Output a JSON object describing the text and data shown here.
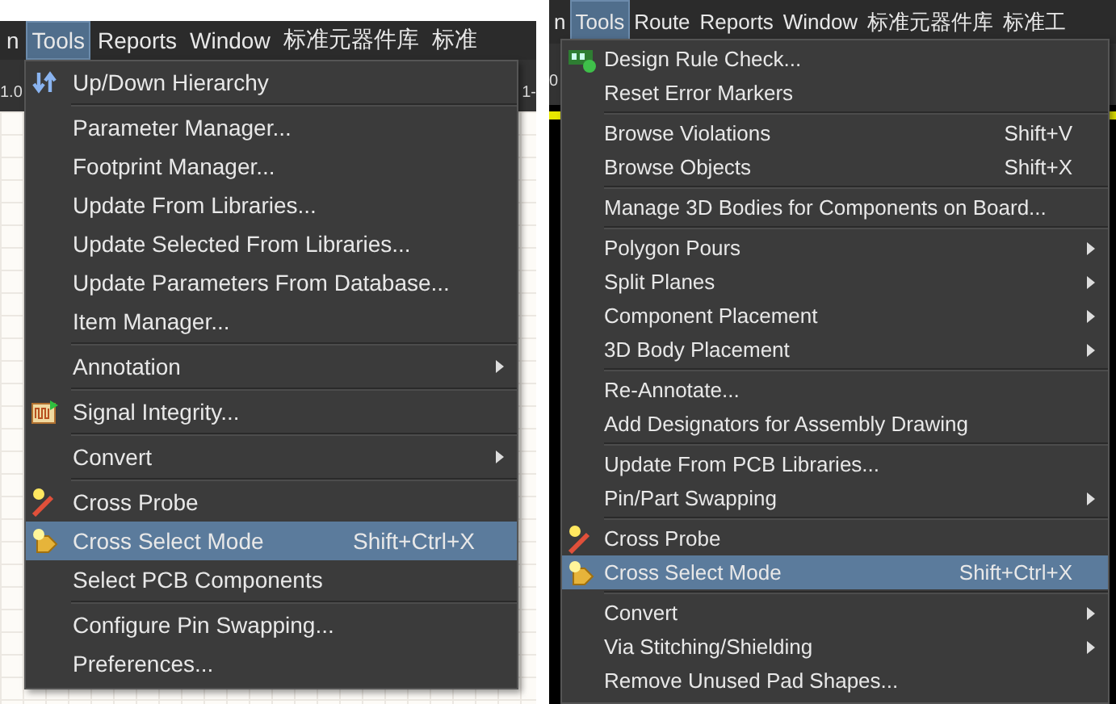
{
  "panels": [
    {
      "menu_bar": [
        {
          "label": "n",
          "selected": false
        },
        {
          "label": "Tools",
          "selected": true
        },
        {
          "label": "Reports",
          "selected": false
        },
        {
          "label": "Window",
          "selected": false
        },
        {
          "label": "标准元器件库",
          "selected": false
        },
        {
          "label": "标准",
          "selected": false
        }
      ],
      "toolbar": [
        "1.0",
        "1-"
      ],
      "menu": [
        {
          "kind": "hierarchy",
          "label": "Up/Down Hierarchy",
          "selected": false
        },
        {
          "kind": "plain",
          "label": "Parameter Manager...",
          "separator_before": true,
          "selected": false
        },
        {
          "kind": "plain",
          "label": "Footprint Manager...",
          "selected": false
        },
        {
          "kind": "plain",
          "label": "Update From Libraries...",
          "selected": false
        },
        {
          "kind": "plain",
          "label": "Update Selected From Libraries...",
          "selected": false
        },
        {
          "kind": "plain",
          "label": "Update Parameters From Database...",
          "selected": false
        },
        {
          "kind": "plain",
          "label": "Item Manager...",
          "selected": false
        },
        {
          "kind": "plain",
          "label": "Annotation",
          "separator_before": true,
          "selected": false,
          "submenu": true
        },
        {
          "kind": "signal",
          "label": "Signal Integrity...",
          "separator_before": true,
          "selected": false
        },
        {
          "kind": "plain",
          "label": "Convert",
          "separator_before": true,
          "selected": false,
          "submenu": true
        },
        {
          "kind": "probe",
          "label": "Cross Probe",
          "separator_before": true,
          "selected": false
        },
        {
          "kind": "cross-select",
          "label": "Cross Select Mode",
          "shortcut": "Shift+Ctrl+X",
          "selected": true
        },
        {
          "kind": "plain",
          "label": "Select PCB Components",
          "selected": false
        },
        {
          "kind": "plain",
          "label": "Configure Pin Swapping...",
          "separator_before": true,
          "selected": false
        },
        {
          "kind": "plain",
          "label": "Preferences...",
          "selected": false
        }
      ]
    },
    {
      "menu_bar": [
        {
          "label": "n",
          "selected": false
        },
        {
          "label": "Tools",
          "selected": true
        },
        {
          "label": "Route",
          "selected": false
        },
        {
          "label": "Reports",
          "selected": false
        },
        {
          "label": "Window",
          "selected": false
        },
        {
          "label": "标准元器件库",
          "selected": false
        },
        {
          "label": "标准工",
          "selected": false
        }
      ],
      "toolbar": [
        "0"
      ],
      "menu": [
        {
          "kind": "drc",
          "label": "Design Rule Check...",
          "selected": false
        },
        {
          "kind": "plain",
          "label": "Reset Error Markers",
          "selected": false
        },
        {
          "kind": "plain",
          "label": "Browse Violations",
          "shortcut": "Shift+V",
          "separator_before": true,
          "selected": false
        },
        {
          "kind": "plain",
          "label": "Browse Objects",
          "shortcut": "Shift+X",
          "selected": false
        },
        {
          "kind": "plain",
          "label": "Manage 3D Bodies for Components on Board...",
          "separator_before": true,
          "selected": false
        },
        {
          "kind": "plain",
          "label": "Polygon Pours",
          "separator_before": true,
          "selected": false,
          "submenu": true
        },
        {
          "kind": "plain",
          "label": "Split Planes",
          "selected": false,
          "submenu": true
        },
        {
          "kind": "plain",
          "label": "Component Placement",
          "selected": false,
          "submenu": true
        },
        {
          "kind": "plain",
          "label": "3D Body Placement",
          "selected": false,
          "submenu": true
        },
        {
          "kind": "plain",
          "label": "Re-Annotate...",
          "separator_before": true,
          "selected": false
        },
        {
          "kind": "plain",
          "label": "Add Designators for Assembly Drawing",
          "selected": false
        },
        {
          "kind": "plain",
          "label": "Update From PCB Libraries...",
          "separator_before": true,
          "selected": false
        },
        {
          "kind": "plain",
          "label": "Pin/Part Swapping",
          "selected": false,
          "submenu": true
        },
        {
          "kind": "probe",
          "label": "Cross Probe",
          "separator_before": true,
          "selected": false
        },
        {
          "kind": "cross-select",
          "label": "Cross Select Mode",
          "shortcut": "Shift+Ctrl+X",
          "selected": true
        },
        {
          "kind": "plain",
          "label": "Convert",
          "separator_before": true,
          "selected": false,
          "submenu": true
        },
        {
          "kind": "plain",
          "label": "Via Stitching/Shielding",
          "selected": false,
          "submenu": true
        },
        {
          "kind": "plain",
          "label": "Remove Unused Pad Shapes...",
          "selected": false
        }
      ]
    }
  ]
}
